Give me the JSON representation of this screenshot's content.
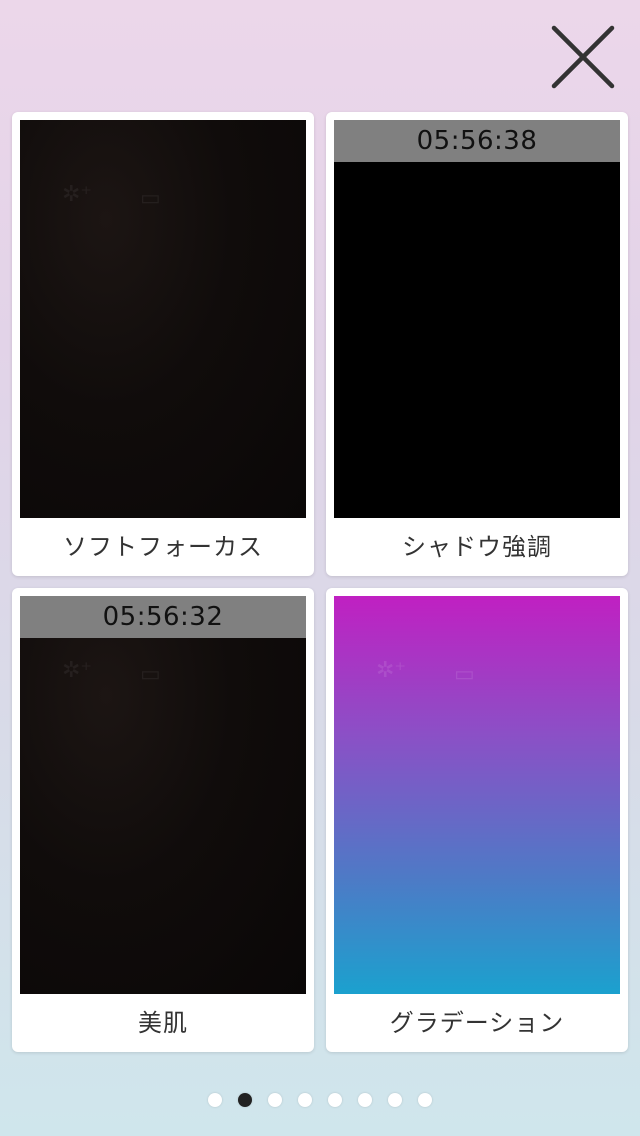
{
  "header": {
    "close_icon": "close-icon"
  },
  "filters": [
    {
      "label": "ソフトフォーカス",
      "timestamp": "",
      "preview": "dark-cam"
    },
    {
      "label": "シャドウ強調",
      "timestamp": "05:56:38",
      "preview": "black"
    },
    {
      "label": "美肌",
      "timestamp": "05:56:32",
      "preview": "dark-cam"
    },
    {
      "label": "グラデーション",
      "timestamp": "",
      "preview": "gradient"
    }
  ],
  "pagination": {
    "total": 8,
    "current": 2
  },
  "colors": {
    "gradient_top": "#c020c2",
    "gradient_bottom": "#1ba1ce",
    "timestamp_bar": "#808080",
    "active_dot": "#222222"
  }
}
